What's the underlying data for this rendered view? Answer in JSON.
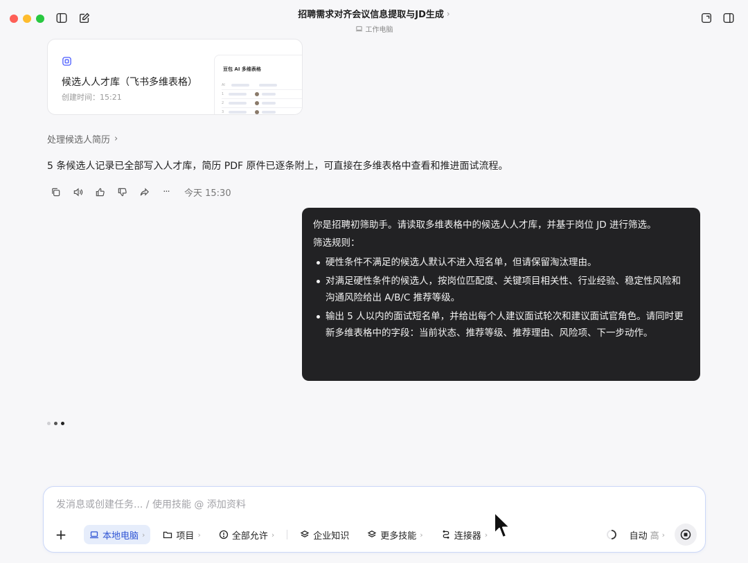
{
  "window": {
    "title": "招聘需求对齐会议信息提取与JD生成",
    "title_chevron": "›",
    "subtitle": "工作电脑"
  },
  "card": {
    "title": "候选人人才库（飞书多维表格）",
    "created": "创建时间：15:21",
    "preview_title": "豆包 AI 多维表格",
    "preview_rows": [
      "1",
      "2",
      "3"
    ]
  },
  "section": {
    "label": "处理候选人简历",
    "chevron": "›"
  },
  "assistant_message": "5 条候选人记录已全部写入人才库，简历 PDF 原件已逐条附上，可直接在多维表格中查看和推进面试流程。",
  "actions": {
    "time": "今天 15:30",
    "more": "···"
  },
  "user_message": {
    "intro": "你是招聘初筛助手。请读取多维表格中的候选人人才库，并基于岗位 JD 进行筛选。",
    "rules_label": "筛选规则：",
    "rules": [
      "硬性条件不满足的候选人默认不进入短名单，但请保留淘汰理由。",
      "对满足硬性条件的候选人，按岗位匹配度、关键项目相关性、行业经验、稳定性风险和沟通风险给出 A/B/C 推荐等级。",
      "输出 5 人以内的面试短名单，并给出每个人建议面试轮次和建议面试官角色。请同时更新多维表格中的字段：当前状态、推荐等级、推荐理由、风险项、下一步动作。"
    ]
  },
  "composer": {
    "placeholder": "发消息或创建任务... / 使用技能 @ 添加资料",
    "plus": "+",
    "chips": {
      "local": "本地电脑",
      "project": "项目",
      "permission": "全部允许",
      "knowledge": "企业知识",
      "skills": "更多技能",
      "connector": "连接器"
    },
    "chevron": "›",
    "mode": "自动",
    "level": "高"
  },
  "colors": {
    "accent": "#2f55d4",
    "bubble": "#222224",
    "background": "#f7f7f9"
  }
}
